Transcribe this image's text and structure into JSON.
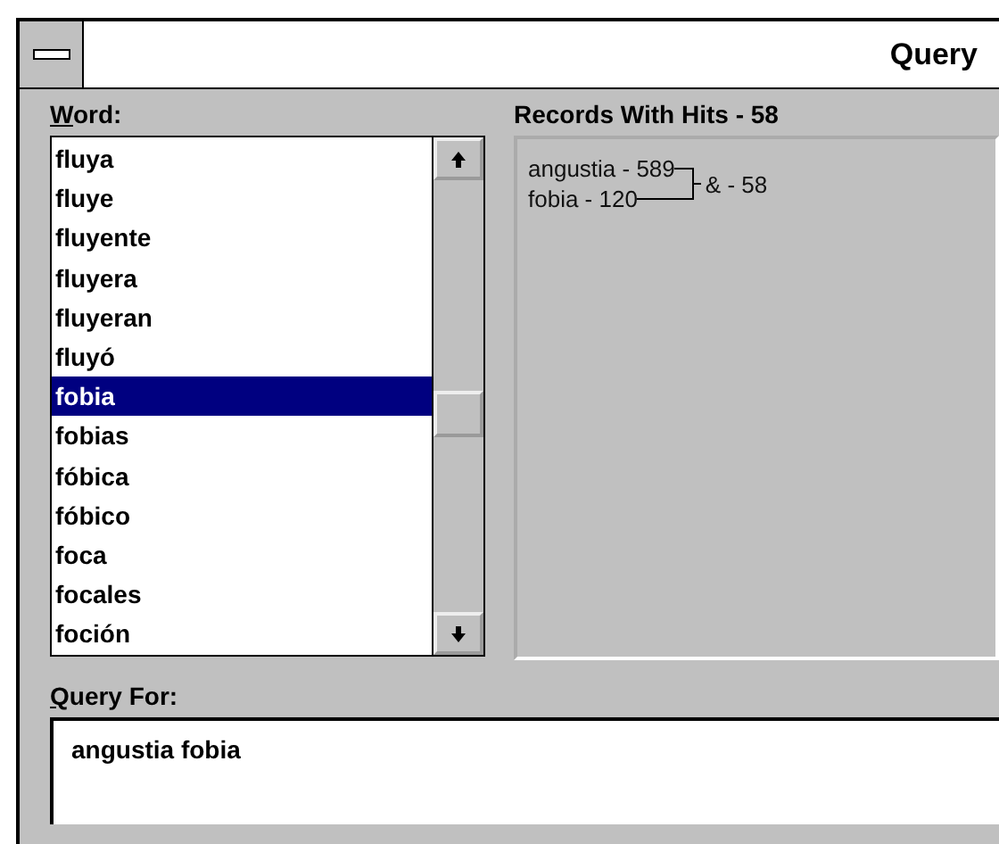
{
  "window": {
    "title": "Query"
  },
  "word_label": "Word:",
  "words": [
    {
      "text": "fluya",
      "selected": false
    },
    {
      "text": "fluye",
      "selected": false
    },
    {
      "text": "fluyente",
      "selected": false
    },
    {
      "text": "fluyera",
      "selected": false
    },
    {
      "text": "fluyeran",
      "selected": false
    },
    {
      "text": "fluyó",
      "selected": false
    },
    {
      "text": "fobia",
      "selected": true
    },
    {
      "text": "fobias",
      "selected": false
    },
    {
      "text": "fóbica",
      "selected": false
    },
    {
      "text": "fóbico",
      "selected": false
    },
    {
      "text": "foca",
      "selected": false
    },
    {
      "text": "focales",
      "selected": false
    },
    {
      "text": "foción",
      "selected": false
    }
  ],
  "records_label": "Records With Hits - 58",
  "records": {
    "terms": [
      "angustia - 589",
      "fobia - 120"
    ],
    "result": "& - 58"
  },
  "query_label": "Query For:",
  "query": {
    "value": "angustia fobia"
  }
}
